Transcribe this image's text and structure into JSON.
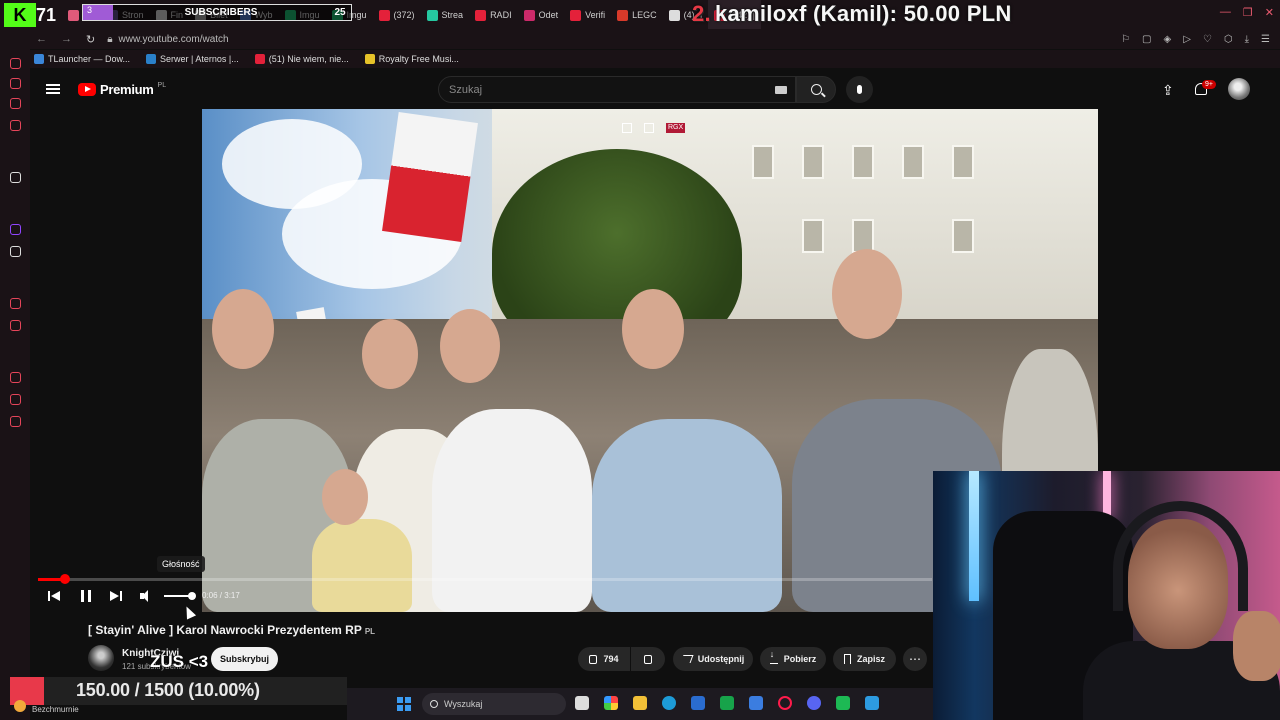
{
  "browser": {
    "tabs": [
      {
        "label": "My",
        "color": "#e05a7a"
      },
      {
        "label": "Stron",
        "color": "#5a4a8a"
      },
      {
        "label": "Fin",
        "color": "#cccccc"
      },
      {
        "label": "Bilet",
        "color": "#999999"
      },
      {
        "label": "Wyb",
        "color": "#4a74c0"
      },
      {
        "label": "Imgu",
        "color": "#1bb76e"
      },
      {
        "label": "Imgu",
        "color": "#1bb76e"
      },
      {
        "label": "(372)",
        "color": "#e4213a"
      },
      {
        "label": "Strea",
        "color": "#25c8a0"
      },
      {
        "label": "RADI",
        "color": "#e4213a"
      },
      {
        "label": "Odet",
        "color": "#cc2a6a"
      },
      {
        "label": "Verifi",
        "color": "#e4213a"
      },
      {
        "label": "LEGC",
        "color": "#d83a2a"
      },
      {
        "label": "(4) n",
        "color": "#dddddd"
      },
      {
        "label": "(142) |",
        "color": "#e4213a"
      }
    ],
    "url": "www.youtube.com/watch",
    "bookmarks": [
      {
        "label": "TLauncher — Dow...",
        "color": "#3b86d9"
      },
      {
        "label": "Serwer | Aternos |...",
        "color": "#2a80c9"
      },
      {
        "label": "(51) Nie wiem, nie...",
        "color": "#e4213a"
      },
      {
        "label": "Royalty Free Musi...",
        "color": "#e6c229"
      }
    ]
  },
  "overlay": {
    "kick_logo": "K",
    "kick_count": "71",
    "subs_current": "3",
    "subs_label": "SUBSCRIBERS",
    "subs_goal": "25",
    "donation_rank": "2.",
    "donation_text": "kamiloxf (Kamil): 50.00 PLN",
    "tip_goal": "150.00 / 1500 (10.00%)",
    "zus_text": "ZUS <3",
    "weather": "Bezchmurnie"
  },
  "youtube": {
    "brand": "Premium",
    "region": "PL",
    "search_placeholder": "Szukaj",
    "notif_badge": "9+",
    "tooltip": "Głośność",
    "time_current": "0:06",
    "time_total": "3:17",
    "progress_fraction": 0.0305,
    "title": "[ Stayin' Alive ] Karol Nawrocki Prezydentem RP",
    "title_flag": "PL",
    "channel": "KnightCziwi",
    "subscribers": "121 subskrybentów",
    "subscribe": "Subskrybuj",
    "likes": "794",
    "share": "Udostępnij",
    "download": "Pobierz",
    "save": "Zapisz"
  },
  "taskbar": {
    "search": "Wyszukaj"
  }
}
